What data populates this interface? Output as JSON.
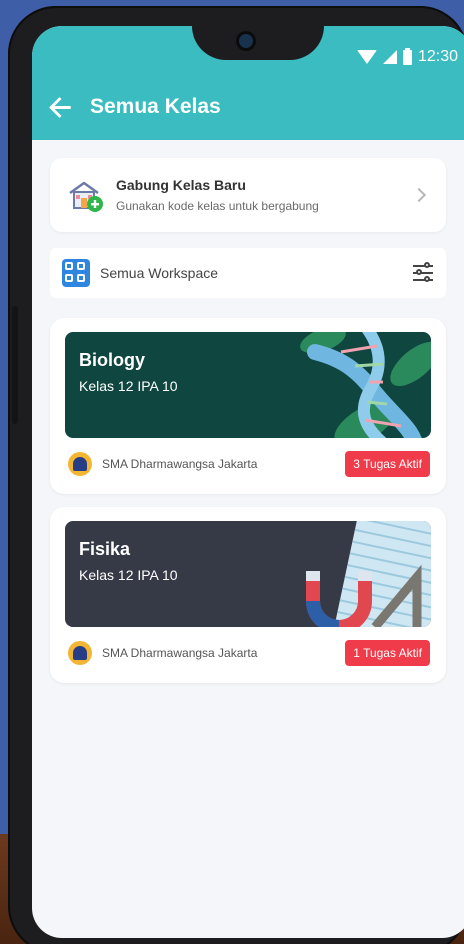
{
  "status_bar": {
    "time": "12:30"
  },
  "app_bar": {
    "title": "Semua Kelas"
  },
  "join_card": {
    "title": "Gabung Kelas Baru",
    "subtitle": "Gunakan kode kelas untuk bergabung"
  },
  "workspace": {
    "label": "Semua Workspace"
  },
  "classes": [
    {
      "name": "Biology",
      "grade": "Kelas 12 IPA 10",
      "school": "SMA Dharmawangsa Jakarta",
      "badge": "3 Tugas Aktif",
      "banner_color": "#0f463f"
    },
    {
      "name": "Fisika",
      "grade": "Kelas 12 IPA 10",
      "school": "SMA Dharmawangsa Jakarta",
      "badge": "1 Tugas Aktif",
      "banner_color": "#363a47"
    }
  ],
  "colors": {
    "accent": "#3bbcc0",
    "badge": "#ef3b4a",
    "workspace_icon": "#2f86e0"
  },
  "icons": {
    "back": "arrow-left-icon",
    "join": "school-add-icon",
    "chevron": "chevron-right-icon",
    "workspace": "grid-icon",
    "filter": "filter-icon"
  }
}
